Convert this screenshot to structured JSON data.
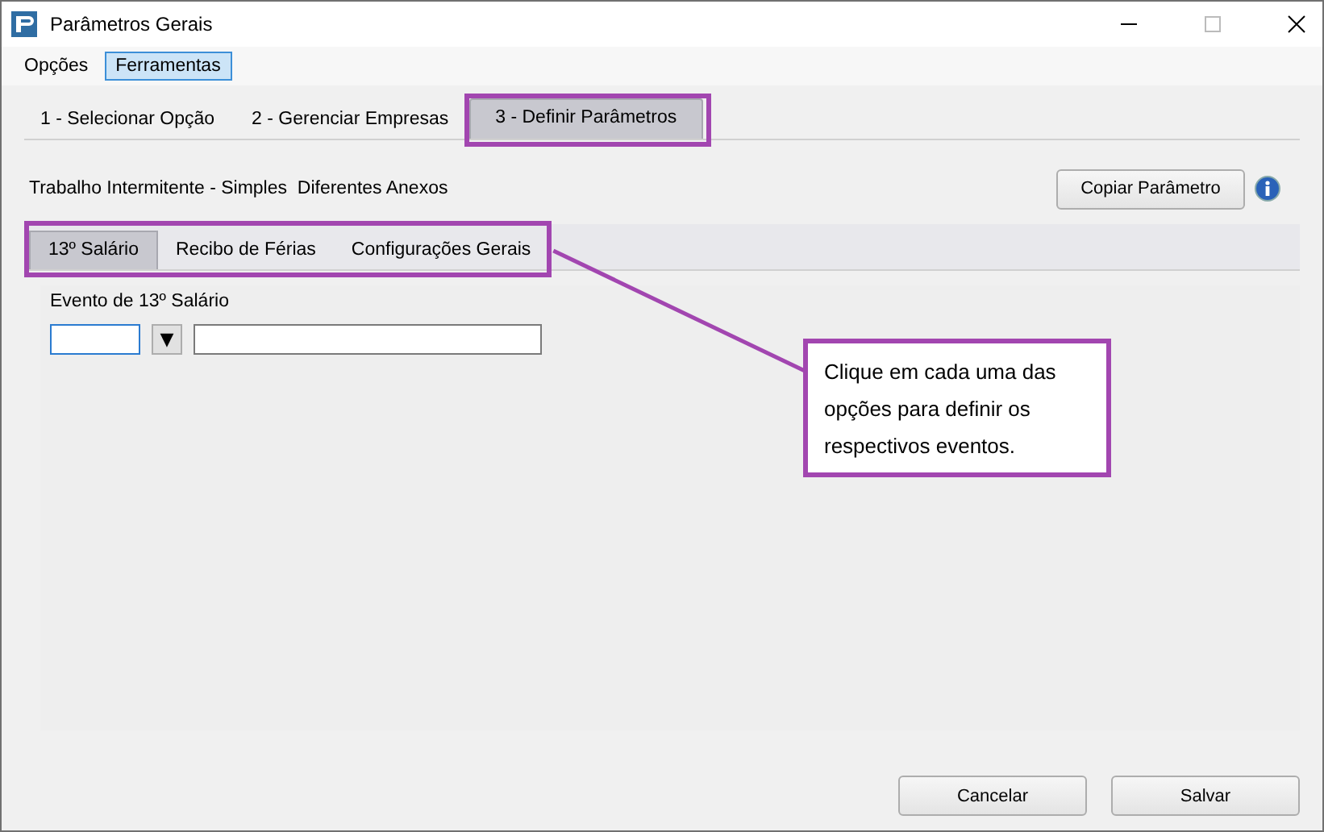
{
  "window": {
    "title": "Parâmetros Gerais"
  },
  "menu": [
    {
      "label": "Opções",
      "selected": false
    },
    {
      "label": "Ferramentas",
      "selected": true
    }
  ],
  "wizard_tabs": [
    {
      "label": "1 - Selecionar Opção",
      "selected": false
    },
    {
      "label": "2 - Gerenciar Empresas",
      "selected": false
    },
    {
      "label": "3 - Definir Parâmetros",
      "selected": true
    }
  ],
  "header": {
    "text": "Trabalho Intermitente - Simples  Diferentes Anexos",
    "button": "Copiar Parâmetro"
  },
  "sub_tabs": [
    {
      "label": "13º Salário",
      "selected": true
    },
    {
      "label": "Recibo de Férias",
      "selected": false
    },
    {
      "label": "Configurações Gerais",
      "selected": false
    }
  ],
  "field": {
    "label": "Evento de 13º Salário",
    "dropdown": "▼"
  },
  "callout": {
    "text": "Clique em cada uma das opções para definir os respectivos eventos."
  },
  "buttons": [
    "Cancelar",
    "Salvar"
  ]
}
